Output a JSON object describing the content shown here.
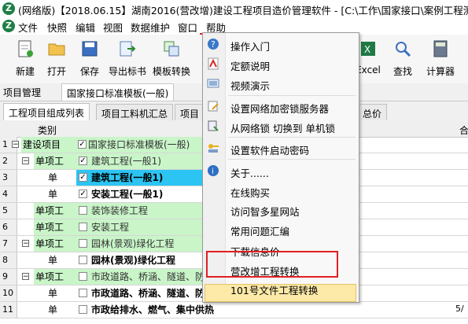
{
  "window": {
    "title": "(网络版)【2018.06.15】湖南2016(营改增)建设工程项目造价管理软件 - [C:\\工作\\国家接口\\案例工程测评("
  },
  "menu": {
    "items": [
      "文件",
      "快照",
      "编辑",
      "视图",
      "数据维护",
      "窗口",
      "帮助"
    ]
  },
  "toolbar": {
    "buttons": [
      {
        "label": "新建",
        "icon": "new-file-icon"
      },
      {
        "label": "打开",
        "icon": "open-folder-icon"
      },
      {
        "label": "保存",
        "icon": "save-icon"
      },
      {
        "label": "导出标书",
        "icon": "export-bid-icon"
      },
      {
        "label": "模板转换",
        "icon": "template-convert-icon"
      },
      {
        "label": "Excel",
        "icon": "excel-icon"
      },
      {
        "label": "查找",
        "icon": "find-icon"
      },
      {
        "label": "计算器",
        "icon": "calculator-icon"
      }
    ]
  },
  "project_tabs": {
    "label": "项目管理",
    "active": "国家接口标准模板(一般)"
  },
  "sub_tabs": [
    "工程项目组成列表",
    "项目工料机汇总",
    "项目",
    "总价"
  ],
  "grid": {
    "header": {
      "type": "类别",
      "right": "合"
    },
    "rows": [
      {
        "num": "1",
        "type": "建设项目",
        "checked": true,
        "name": "国家接口标准模板(一般)",
        "bold": false,
        "bg": "#c9f5c9"
      },
      {
        "num": "2",
        "type": "单项工",
        "checked": true,
        "name": "建筑工程(一般1)",
        "bold": false,
        "bg": "#c9f5c9"
      },
      {
        "num": "3",
        "type": "单",
        "checked": true,
        "name": "建筑工程(一般1)",
        "bold": true,
        "bg": "#2cc4f2"
      },
      {
        "num": "4",
        "type": "单",
        "checked": true,
        "name": "安装工程(一般1)",
        "bold": true,
        "bg": "#ffffff"
      },
      {
        "num": "5",
        "type": "单项工",
        "checked": false,
        "name": "装饰装修工程",
        "bold": false,
        "bg": "#c9f5c9"
      },
      {
        "num": "6",
        "type": "单项工",
        "checked": false,
        "name": "安装工程",
        "bold": false,
        "bg": "#c9f5c9"
      },
      {
        "num": "7",
        "type": "单项工",
        "checked": false,
        "name": "园林(景观)绿化工程",
        "bold": false,
        "bg": "#c9f5c9"
      },
      {
        "num": "8",
        "type": "单",
        "checked": false,
        "name": "园林(景观)绿化工程",
        "bold": true,
        "bg": "#ffffff"
      },
      {
        "num": "9",
        "type": "单项工",
        "checked": false,
        "name": "市政道路、桥涵、隧道、防",
        "bold": false,
        "bg": "#c9f5c9"
      },
      {
        "num": "10",
        "type": "单",
        "checked": false,
        "name": "市政道路、桥涵、隧道、防洪堤",
        "bold": true,
        "bg": "#ffffff"
      },
      {
        "num": "11",
        "type": "单",
        "checked": false,
        "name": "市政给排水、燃气、集中供热",
        "bold": true,
        "bg": "#ffffff"
      }
    ],
    "right_col_visible": "5/"
  },
  "help_menu": {
    "items": [
      {
        "label": "操作入门",
        "icon": "question-icon"
      },
      {
        "label": "定额说明",
        "icon": "pdf-icon"
      },
      {
        "label": "视频演示",
        "icon": "video-icon"
      },
      {
        "label": "设置网络加密锁服务器",
        "icon": "edit-icon"
      },
      {
        "label": "从网络锁 切换到 单机锁",
        "icon": "lock-icon"
      },
      {
        "label": "设置软件启动密码",
        "icon": "key-icon"
      },
      {
        "label": "关于......",
        "icon": "info-icon"
      },
      {
        "label": "在线购买",
        "icon": ""
      },
      {
        "label": "访问智多星网站",
        "icon": ""
      },
      {
        "label": "常用问题汇编",
        "icon": ""
      },
      {
        "label": "下载信息价",
        "icon": ""
      },
      {
        "label": "营改增工程转换",
        "icon": ""
      },
      {
        "label": "101号文件工程转换",
        "icon": ""
      }
    ]
  }
}
